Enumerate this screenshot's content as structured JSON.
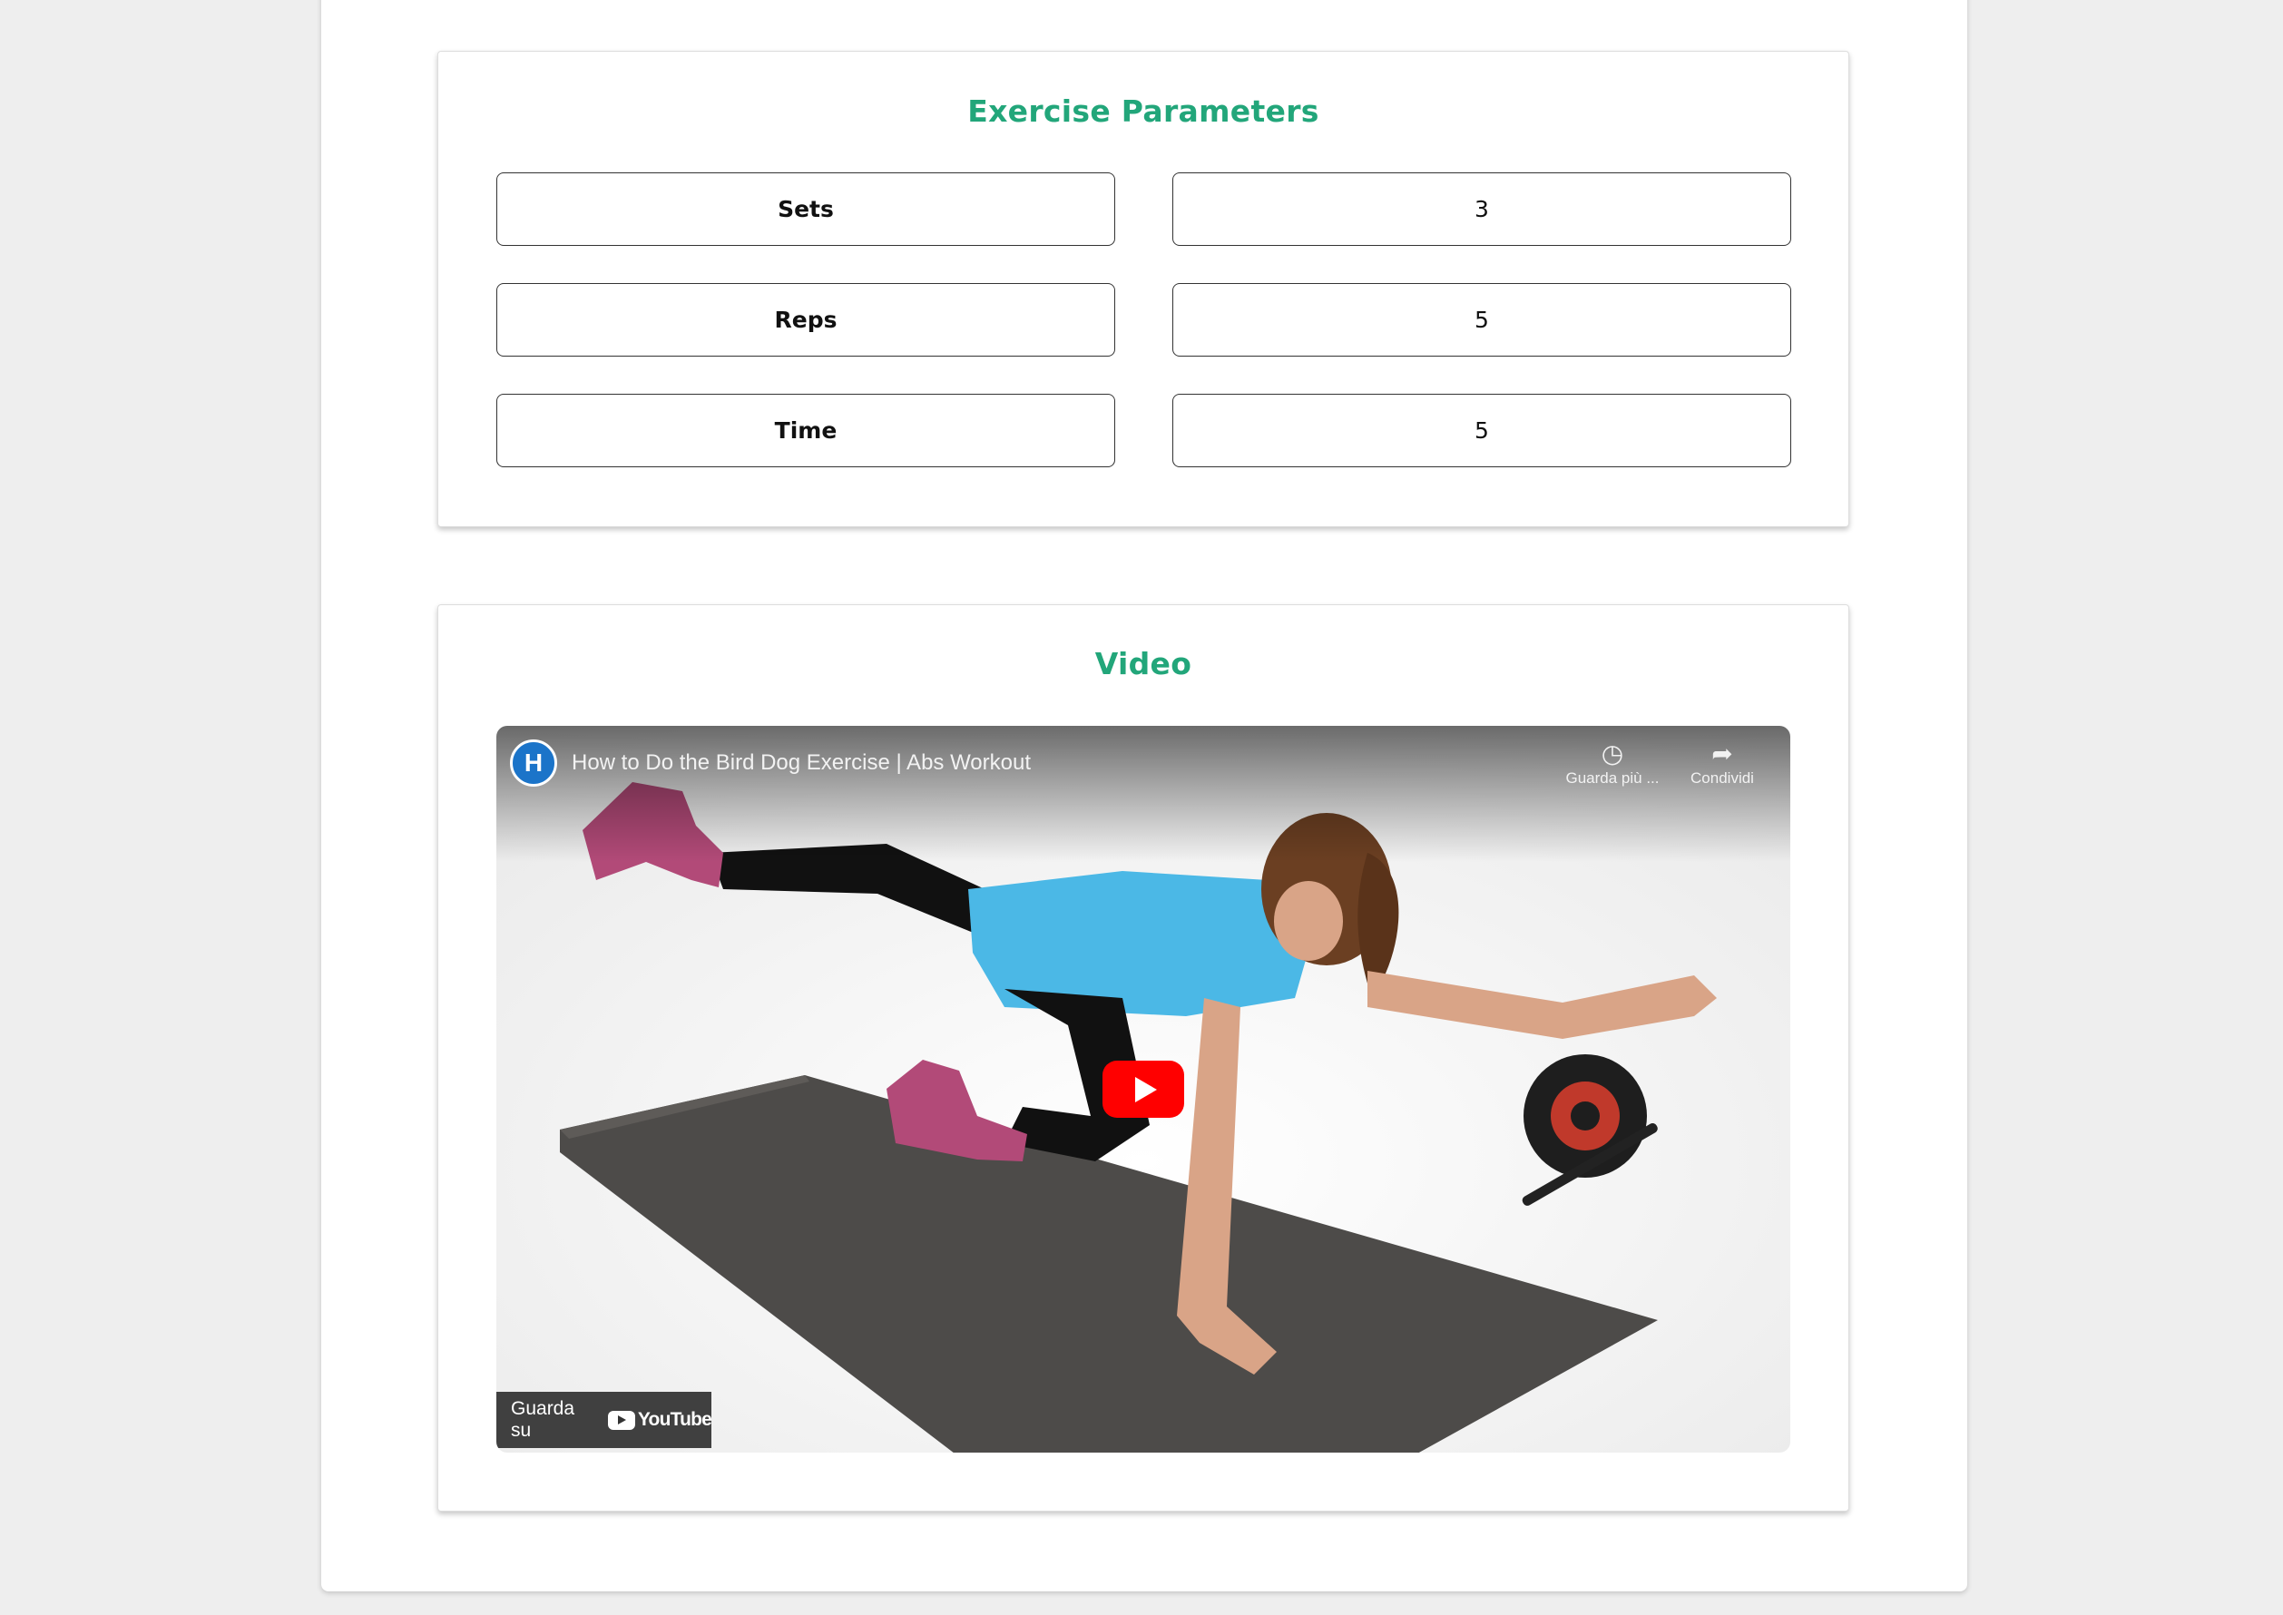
{
  "params_panel": {
    "title": "Exercise Parameters",
    "rows": [
      {
        "label": "Sets",
        "value": "3"
      },
      {
        "label": "Reps",
        "value": "5"
      },
      {
        "label": "Time",
        "value": "5"
      }
    ]
  },
  "video_panel": {
    "title": "Video",
    "player": {
      "channel_logo_letter": "H",
      "video_title": "How to Do the Bird Dog Exercise | Abs Workout",
      "watch_later_label": "Guarda più ...",
      "share_label": "Condividi",
      "watch_on_label": "Guarda su",
      "youtube_word": "YouTube",
      "play_icon": "play-icon"
    }
  },
  "colors": {
    "accent": "#22a67a",
    "play_red": "#ff0000",
    "channel_blue": "#1b74c9"
  }
}
